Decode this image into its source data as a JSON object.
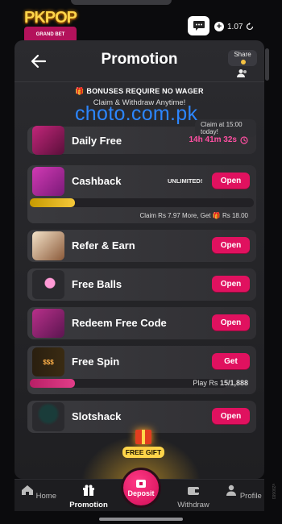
{
  "app": {
    "logo_text": "PKPOP",
    "logo_sub": "GRAND BET"
  },
  "header": {
    "balance": "1.07"
  },
  "nav": {
    "title": "Promotion",
    "share_label": "Share"
  },
  "banner": {
    "line1": "BONUSES REQUIRE NO WAGER",
    "line2": "Claim & Withdraw Anytime!"
  },
  "watermark": "choto.com.pk",
  "cards": {
    "daily_free": {
      "title": "Daily Free",
      "claim_note": "Claim at 15:00 today!",
      "timer": "14h 41m 32s"
    },
    "cashback": {
      "title": "Cashback",
      "badge": "UNLIMITED!",
      "button": "Open",
      "progress": 0.2,
      "note": "Claim Rs 7.97 More, Get",
      "reward": "Rs 18.00"
    },
    "refer": {
      "title": "Refer & Earn",
      "button": "Open"
    },
    "free_balls": {
      "title": "Free Balls",
      "button": "Open"
    },
    "redeem": {
      "title": "Redeem Free Code",
      "button": "Open"
    },
    "free_spin": {
      "title": "Free Spin",
      "button": "Get",
      "progress": 0.23,
      "note_prefix": "Play Rs",
      "note_value": "15/1,888",
      "thumb_text": "$$$"
    },
    "slotshack": {
      "title": "Slotshack",
      "button": "Open"
    }
  },
  "free_gift": {
    "label": "FREE GIFT"
  },
  "tabs": {
    "home": "Home",
    "promotion": "Promotion",
    "deposit": "Deposit",
    "withdraw": "Withdraw",
    "profile": "Profile"
  },
  "side_id": "v290683"
}
